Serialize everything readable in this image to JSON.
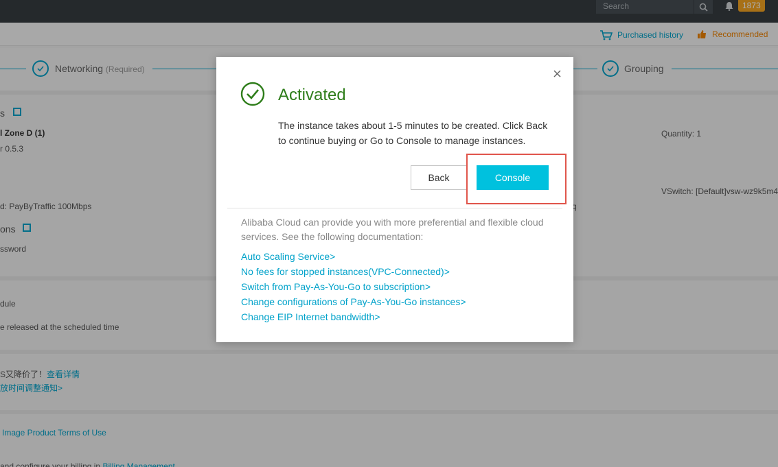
{
  "topbar": {
    "search_placeholder": "Search",
    "notification_count": "1873"
  },
  "subbar": {
    "purchased_history": "Purchased history",
    "recommended": "Recommended"
  },
  "steps": {
    "networking": "Networking",
    "networking_required": "(Required)",
    "grouping": "Grouping"
  },
  "background": {
    "row1_fragment": "s",
    "zone": "l Zone D (1)",
    "version": "r 0.5.3",
    "bandwidth": "d:  PayByTraffic 100Mbps",
    "section2": "ons",
    "password": "ssword",
    "quantity": "Quantity:  1",
    "vswitch": "VSwitch:  [Default]vsw-wz9k5m4",
    "q_fragment": "q",
    "schedule": "dule",
    "released": "e released at the scheduled time",
    "promo1_text": "S又降价了！",
    "promo1_link": "查看详情",
    "promo2_link": "放时间调整通知>",
    "terms_link": "Image Product Terms of Use",
    "billing_text": "and configure your billing in",
    "billing_link": "Billing Management"
  },
  "modal": {
    "title": "Activated",
    "message": "The instance takes about 1-5 minutes to be created. Click Back to continue buying or Go to Console to manage instances.",
    "back_label": "Back",
    "console_label": "Console",
    "info_text": "Alibaba Cloud can provide you with more preferential and flexible cloud services. See the following documentation:",
    "links": [
      "Auto Scaling Service>",
      "No fees for stopped instances(VPC-Connected)>",
      "Switch from Pay-As-You-Go to subscription>",
      "Change configurations of Pay-As-You-Go instances>",
      "Change EIP Internet bandwidth>"
    ]
  },
  "colors": {
    "accent": "#00a2ca",
    "console_button": "#00c1de",
    "activated_green": "#2e7d1a",
    "highlight": "#e0554b"
  }
}
